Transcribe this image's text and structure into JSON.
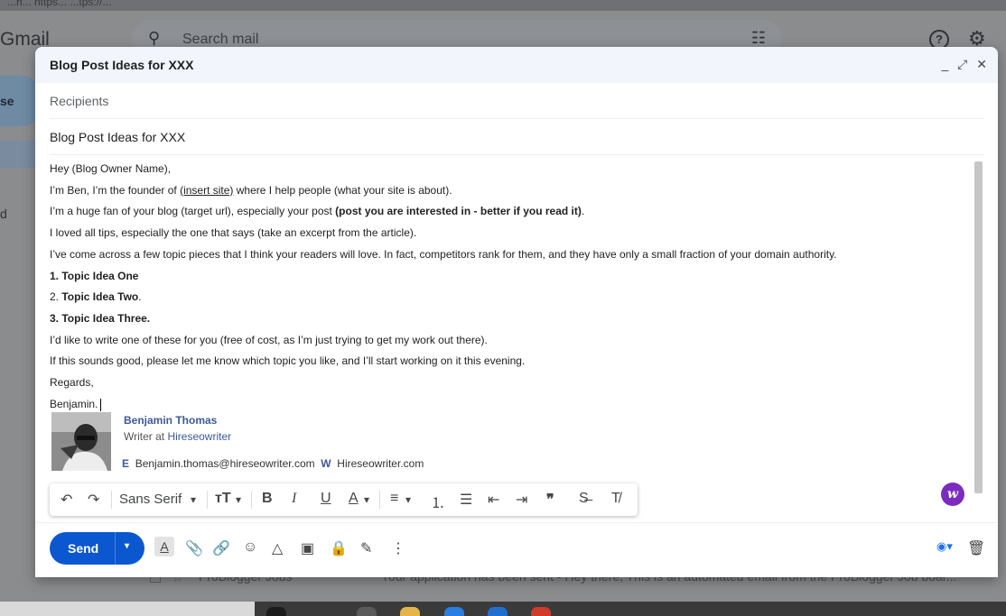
{
  "browser": {
    "url_fragment": "...h... https... ...tps://..."
  },
  "gmail": {
    "logo": "Gmail",
    "search_placeholder": "Search mail",
    "compose_fragment": "se",
    "side_fragment": "d",
    "bg_row": {
      "sender": "ProBlogger Jobs",
      "subject": "Your application has been sent - Hey there, This is an automated email from the ProBlogger Job boar..."
    }
  },
  "compose": {
    "header_title": "Blog Post Ideas for XXX",
    "controls": {
      "minimize": "_",
      "fullscreen": "⤢",
      "close": "✕"
    },
    "recipients_placeholder": "Recipients",
    "subject": "Blog Post Ideas for XXX",
    "body": {
      "greeting": "Hey (Blog Owner Name),",
      "line2_a": "I’m Ben, I’m the founder of ",
      "line2_link": "(insert site)",
      "line2_b": " where I help people (what your site is about).",
      "line3_a": "I’m a huge fan of your blog (target url), especially your post ",
      "line3_bold": "(post you are interested in - better if you read it)",
      "line3_b": ".",
      "line4": "I loved all tips, especially the one that says (take an excerpt from the article).",
      "line5": "I’ve come across a few topic pieces that I think your readers will love. In fact, competitors rank for them, and they have only a small fraction of your domain authority.",
      "topic1": "1. Topic Idea One",
      "topic2_num": "2. ",
      "topic2_text": "Topic Idea Two",
      "topic2_end": ".",
      "topic3": "3. Topic Idea Three.",
      "line9": "I’d like to write one of these for you (free of cost, as I’m just trying to get my work out there).",
      "line10": "If this sounds good, please let me know which topic you like, and I’ll start working on it this evening.",
      "regards": "Regards,",
      "signoff": "Benjamin."
    },
    "signature": {
      "name": "Benjamin Thomas",
      "role_prefix": "Writer at ",
      "role_company": "Hireseowriter",
      "email_label": "E",
      "email": "Benjamin.thomas@hireseowriter.com",
      "web_label": "W",
      "web": "Hireseowriter.com"
    },
    "format_toolbar": {
      "undo": "↶",
      "redo": "↷",
      "font": "Sans Serif",
      "font_arrow": "▾",
      "size": "тT",
      "size_arrow": "▾",
      "bold": "B",
      "italic": "I",
      "underline": "U",
      "text_color": "A",
      "text_color_arrow": "▾",
      "align": "≡",
      "align_arrow": "▾",
      "numbered_list": "⒈",
      "bulleted_list": "☰",
      "indent_less": "⇤",
      "indent_more": "⇥",
      "quote": "❞",
      "strikethrough": "S̶",
      "remove_format": "T̸"
    },
    "ext_badge": "w",
    "send_label": "Send",
    "send_arrow": "▾",
    "bottom_icons": {
      "formatting": "A",
      "attach": "📎",
      "link": "🔗",
      "emoji": "☺",
      "drive": "△",
      "photo": "▣",
      "confidential": "🔒",
      "signature": "✎",
      "more": "⋮",
      "ai": "◉▾",
      "discard": "🗑"
    }
  }
}
